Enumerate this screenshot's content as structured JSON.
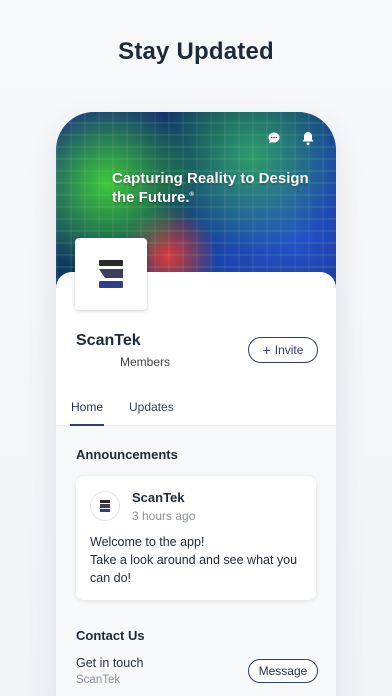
{
  "headline": "Stay Updated",
  "hero": {
    "tagline": "Capturing Reality to Design the Future.",
    "tagline_mark": "®",
    "icons": [
      "chat-icon",
      "bell-icon"
    ]
  },
  "profile": {
    "name": "ScanTek",
    "members_label": "Members",
    "invite_label": "Invite"
  },
  "tabs": [
    {
      "label": "Home",
      "active": true
    },
    {
      "label": "Updates",
      "active": false
    }
  ],
  "announcements": {
    "title": "Announcements",
    "post": {
      "author": "ScanTek",
      "time": "3 hours ago",
      "line1": "Welcome to the app!",
      "line2": "Take a look around and see what you can do!"
    }
  },
  "contact": {
    "title": "Contact Us",
    "label": "Get in touch",
    "sub": "ScanTek",
    "button_label": "Message"
  },
  "colors": {
    "accent": "#2f3e7a",
    "background": "#f3f5f8"
  }
}
